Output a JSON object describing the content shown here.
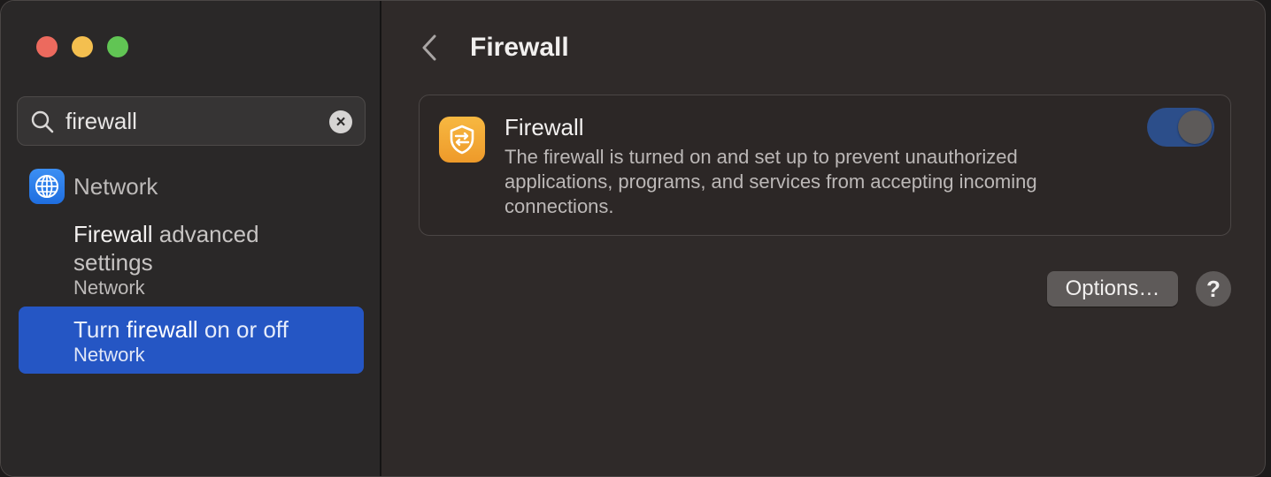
{
  "search": {
    "value": "firewall",
    "clear_label": "×"
  },
  "sidebar": {
    "group_label": "Network",
    "results": [
      {
        "highlight": "Firewall",
        "rest": " advanced settings",
        "section": "Network"
      },
      {
        "prefix": "Turn ",
        "highlight": "firewall",
        "rest": " on or off",
        "section": "Network",
        "selected": true
      }
    ]
  },
  "main": {
    "title": "Firewall",
    "card": {
      "title": "Firewall",
      "description": "The firewall is turned on and set up to prevent unauthorized applications, programs, and services from accepting incoming connections.",
      "toggle_on": true
    },
    "options_label": "Options…",
    "help_label": "?"
  },
  "colors": {
    "accent": "#2556c4",
    "close": "#ec6a5e",
    "minimize": "#f4bf4f",
    "zoom": "#61c554",
    "firewall_icon": "#f2a834",
    "network_icon": "#2f82ee"
  }
}
